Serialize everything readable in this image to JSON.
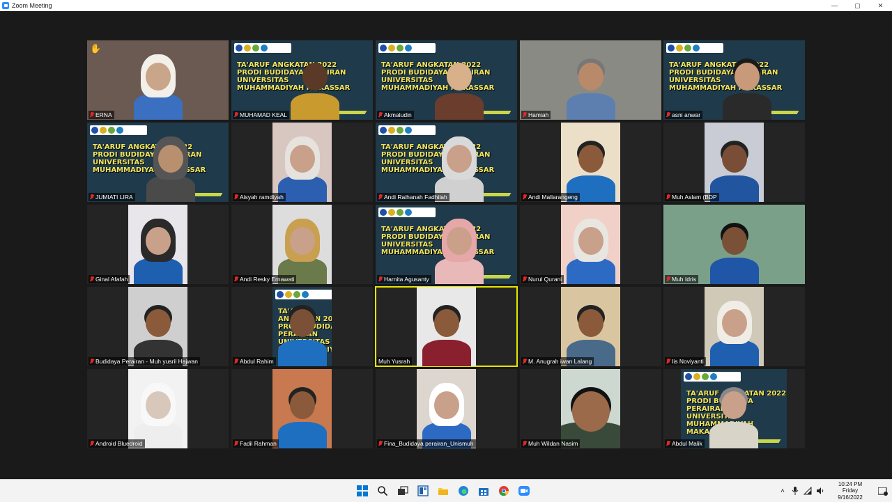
{
  "window": {
    "title": "Zoom Meeting",
    "controls": [
      "—",
      "▢",
      "✕"
    ]
  },
  "colors": {
    "active_speaker": "#e6e600",
    "muted": "#e02828",
    "banner_bg": "#1f3a4a",
    "banner_text": "#f2e45a"
  },
  "banner": {
    "lines": [
      "TA'ARUF ANGKATAN 2022",
      "PRODI BUDIDAYA PERAIRAN",
      "UNIVERSITAS",
      "MUHAMMADIYAH MAKASSAR"
    ]
  },
  "participants": [
    {
      "name": "ERNA"
    },
    {
      "name": "MUHAMAD  KEAL"
    },
    {
      "name": "Akmaludin"
    },
    {
      "name": "Hamiah"
    },
    {
      "name": "asni anwar"
    },
    {
      "name": "JUMIATI LIRA"
    },
    {
      "name": "Aisyah ramdiyah"
    },
    {
      "name": "Andi Raihanah Fadhilah"
    },
    {
      "name": "Andi Mallarangeng"
    },
    {
      "name": "Muh Aslam (BDP"
    },
    {
      "name": "Ginal Afafah"
    },
    {
      "name": "Andi Resky Ernawati"
    },
    {
      "name": "Harnita Agusanty"
    },
    {
      "name": "Nurul Qurani"
    },
    {
      "name": "Muh Idris"
    },
    {
      "name": "Budidaya Perairan - Muh yusril Hajwan"
    },
    {
      "name": "Abdul Rahim"
    },
    {
      "name": "Muh Yusrah"
    },
    {
      "name": "M. Anugrah  iwan Lalang"
    },
    {
      "name": "Iis Noviyanti"
    },
    {
      "name": "Android Bluedroid"
    },
    {
      "name": "Fadil Rahman"
    },
    {
      "name": "Fina_Budidaya perairan_Unismuh"
    },
    {
      "name": "Muh Wildan Nasim"
    },
    {
      "name": "Abdul Malik"
    }
  ],
  "taskbar": {
    "apps": [
      "windows-start",
      "search",
      "task-view",
      "widgets",
      "file-explorer",
      "edge",
      "store",
      "chrome",
      "zoom"
    ],
    "clock": {
      "time": "10:24 PM",
      "day": "Friday",
      "date": "9/16/2022"
    },
    "tray_icons": [
      "chevron-up",
      "microphone",
      "network",
      "volume"
    ]
  }
}
